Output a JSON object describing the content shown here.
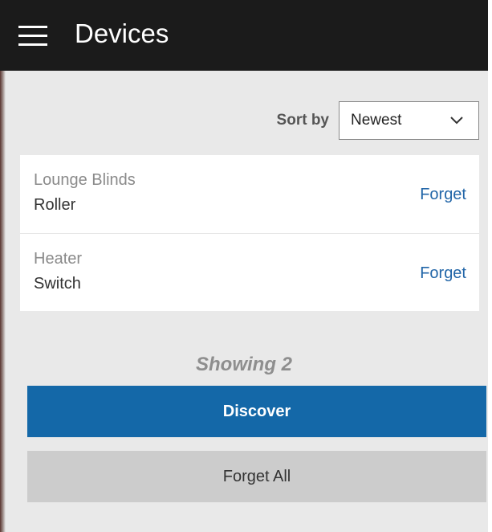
{
  "header": {
    "menu_icon": "hamburger-menu-icon",
    "title": "Devices"
  },
  "sort": {
    "label": "Sort by",
    "selected": "Newest",
    "icon": "chevron-down-icon"
  },
  "devices": [
    {
      "name": "Lounge Blinds",
      "type": "Roller",
      "action": "Forget"
    },
    {
      "name": "Heater",
      "type": "Switch",
      "action": "Forget"
    }
  ],
  "summary": {
    "showing": "Showing 2"
  },
  "actions": {
    "discover_label": "Discover",
    "forget_all_label": "Forget All"
  },
  "colors": {
    "header_bg": "#1b1b1b",
    "page_bg": "#e9e9e9",
    "accent": "#1468a8",
    "link": "#2266a8",
    "secondary_button": "#cccccc"
  }
}
